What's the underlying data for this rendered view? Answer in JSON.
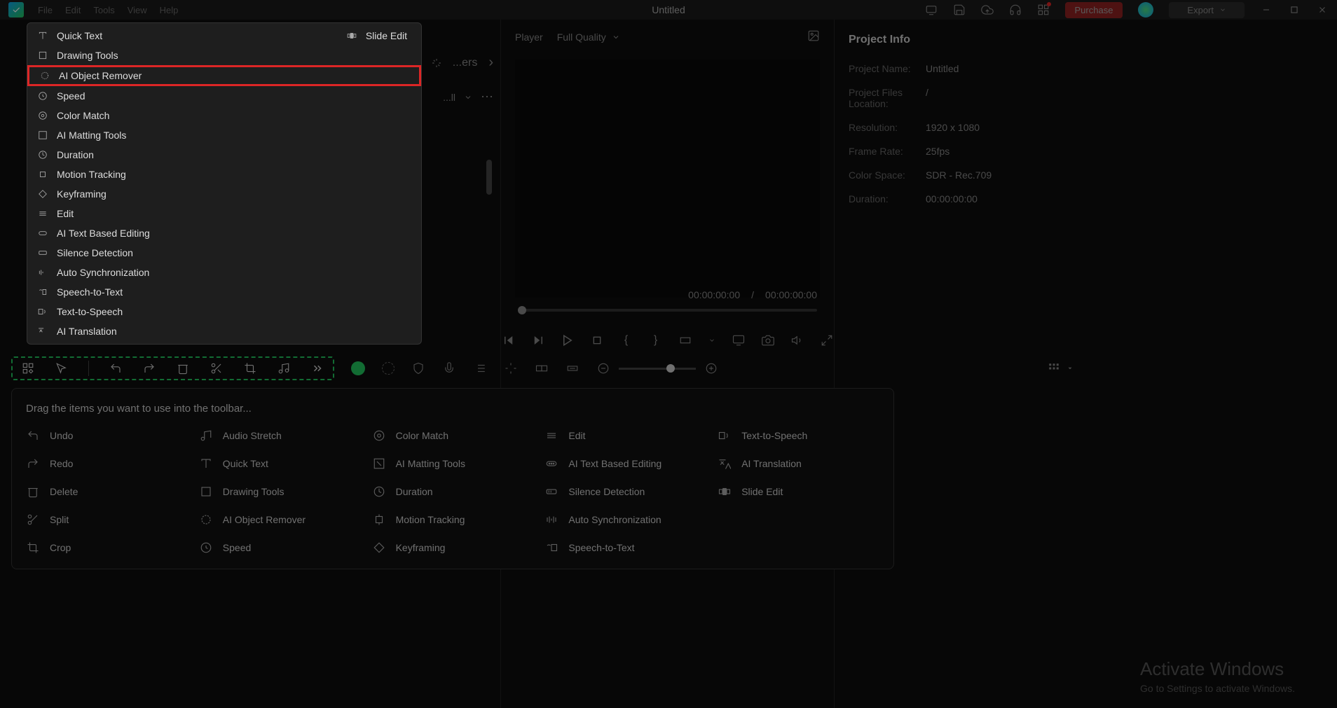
{
  "app": {
    "title": "Untitled"
  },
  "menubar": {
    "file": "File",
    "edit": "Edit",
    "tools": "Tools",
    "view": "View",
    "help": "Help"
  },
  "topright": {
    "purchase": "Purchase",
    "export": "Export"
  },
  "dropdown": {
    "quick_text": "Quick Text",
    "slide_edit": "Slide Edit",
    "drawing_tools": "Drawing Tools",
    "ai_object_remover": "AI Object Remover",
    "speed": "Speed",
    "color_match": "Color Match",
    "ai_matting": "AI Matting Tools",
    "duration": "Duration",
    "motion_tracking": "Motion Tracking",
    "keyframing": "Keyframing",
    "edit": "Edit",
    "ai_text_edit": "AI Text Based Editing",
    "silence_detection": "Silence Detection",
    "auto_sync": "Auto Synchronization",
    "speech_to_text": "Speech-to-Text",
    "text_to_speech": "Text-to-Speech",
    "ai_translation": "AI Translation"
  },
  "tabs_partial": {
    "label": "...ers",
    "filter": "...ll"
  },
  "player": {
    "label": "Player",
    "quality": "Full Quality",
    "time_current": "00:00:00:00",
    "time_sep": "/",
    "time_total": "00:00:00:00"
  },
  "info_panel": {
    "title": "Project Info",
    "name_label": "Project Name:",
    "name_value": "Untitled",
    "location_label": "Project Files Location:",
    "location_value": "/",
    "resolution_label": "Resolution:",
    "resolution_value": "1920 x 1080",
    "framerate_label": "Frame Rate:",
    "framerate_value": "25fps",
    "colorspace_label": "Color Space:",
    "colorspace_value": "SDR - Rec.709",
    "duration_label": "Duration:",
    "duration_value": "00:00:00:00"
  },
  "customize": {
    "title": "Drag the items you want to use into the toolbar...",
    "items": {
      "undo": "Undo",
      "redo": "Redo",
      "delete": "Delete",
      "split": "Split",
      "crop": "Crop",
      "audio_stretch": "Audio Stretch",
      "quick_text": "Quick Text",
      "drawing_tools": "Drawing Tools",
      "ai_object_remover": "AI Object Remover",
      "speed": "Speed",
      "color_match": "Color Match",
      "ai_matting": "AI Matting Tools",
      "duration": "Duration",
      "motion_tracking": "Motion Tracking",
      "keyframing": "Keyframing",
      "edit": "Edit",
      "ai_text_edit": "AI Text Based Editing",
      "silence_detection": "Silence Detection",
      "auto_sync": "Auto Synchronization",
      "speech_to_text": "Speech-to-Text",
      "text_to_speech": "Text-to-Speech",
      "ai_translation": "AI Translation",
      "slide_edit": "Slide Edit"
    }
  },
  "watermark": {
    "title": "Activate Windows",
    "sub": "Go to Settings to activate Windows."
  }
}
